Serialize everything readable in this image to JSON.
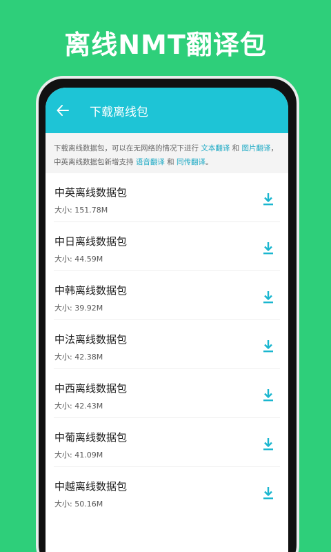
{
  "promo_title": "离线NMT翻译包",
  "colors": {
    "background": "#2ecf7a",
    "appbar": "#1ec4d6",
    "link": "#1ba9c4",
    "download_icon": "#1ab6cf"
  },
  "appbar": {
    "title": "下载离线包",
    "back_icon": "arrow-left-icon"
  },
  "info": {
    "part1": "下载离线数据包，可以在无网络的情况下进行 ",
    "link_text_translate": "文本翻译",
    "and1": " 和 ",
    "link_image_translate": "图片翻译",
    "part2": "，中英离线数据包新增支持 ",
    "link_voice_translate": "语音翻译",
    "and2": " 和 ",
    "link_simul_translate": "同传翻译",
    "end": "。"
  },
  "packages": [
    {
      "name": "中英离线数据包",
      "size": "大小: 151.78M"
    },
    {
      "name": "中日离线数据包",
      "size": "大小: 44.59M"
    },
    {
      "name": "中韩离线数据包",
      "size": "大小: 39.92M"
    },
    {
      "name": "中法离线数据包",
      "size": "大小: 42.38M"
    },
    {
      "name": "中西离线数据包",
      "size": "大小: 42.43M"
    },
    {
      "name": "中葡离线数据包",
      "size": "大小: 41.09M"
    },
    {
      "name": "中越离线数据包",
      "size": "大小: 50.16M"
    }
  ]
}
